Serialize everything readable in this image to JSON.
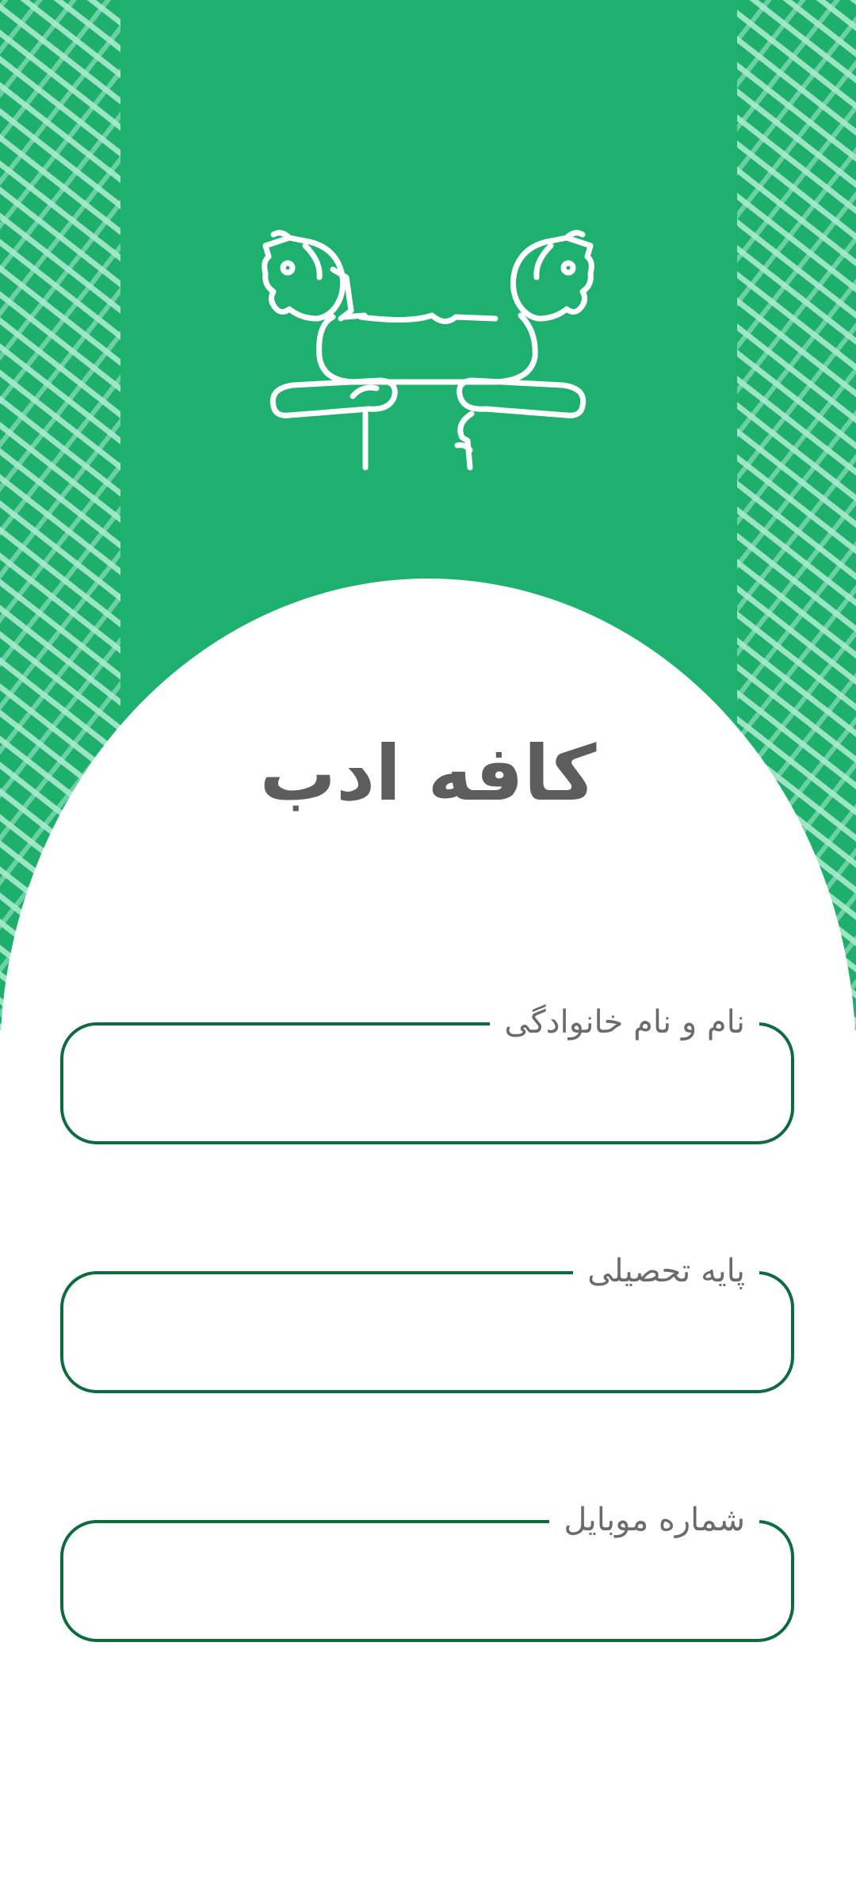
{
  "app": {
    "title": "کافه ادب",
    "logo_icon": "lamassu-horses-icon"
  },
  "colors": {
    "header_green": "#1eb06e",
    "pattern_light": "#aaebcd",
    "field_border": "#0e6b3d",
    "title_gray": "#5d5d5d",
    "label_gray": "#6b6b6b"
  },
  "form": {
    "full_name": {
      "label": "نام و نام خانوادگی",
      "value": ""
    },
    "grade": {
      "label": "پایه تحصیلی",
      "value": ""
    },
    "mobile": {
      "label": "شماره موبایل",
      "value": ""
    }
  }
}
